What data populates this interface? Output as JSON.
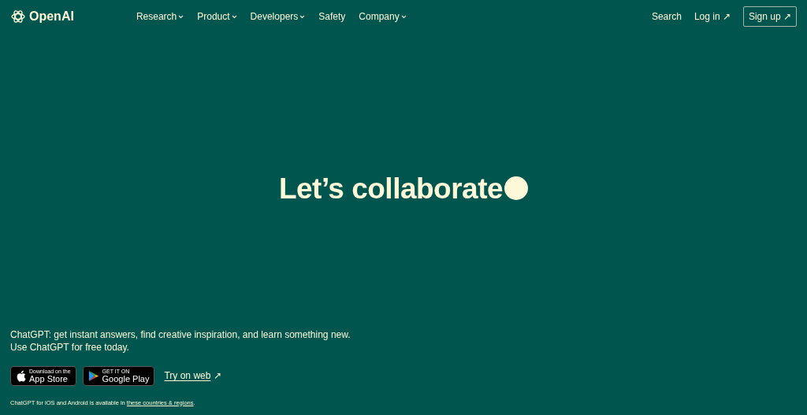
{
  "logo": {
    "text": "OpenAI"
  },
  "nav": [
    {
      "label": "Research",
      "has_menu": true
    },
    {
      "label": "Product",
      "has_menu": true
    },
    {
      "label": "Developers",
      "has_menu": true
    },
    {
      "label": "Safety",
      "has_menu": false
    },
    {
      "label": "Company",
      "has_menu": true
    }
  ],
  "nav_right": {
    "search": "Search",
    "login": "Log in ↗",
    "signup": "Sign up ↗"
  },
  "hero": {
    "title": "Let’s collaborate"
  },
  "intro": [
    "ChatGPT: get instant answers, find creative inspiration, and learn something new.",
    "Use ChatGPT for free today."
  ],
  "stores": [
    {
      "kind": "apple",
      "small": "Download on the",
      "big": "App Store"
    },
    {
      "kind": "google",
      "small": "GET IT ON",
      "big": "Google Play"
    }
  ],
  "web_link": {
    "label": "Try on web",
    "arrow": "↗"
  },
  "footnote": {
    "text": "ChatGPT for iOS and Android is available in ",
    "link": "these countries & regions",
    "end": "."
  }
}
